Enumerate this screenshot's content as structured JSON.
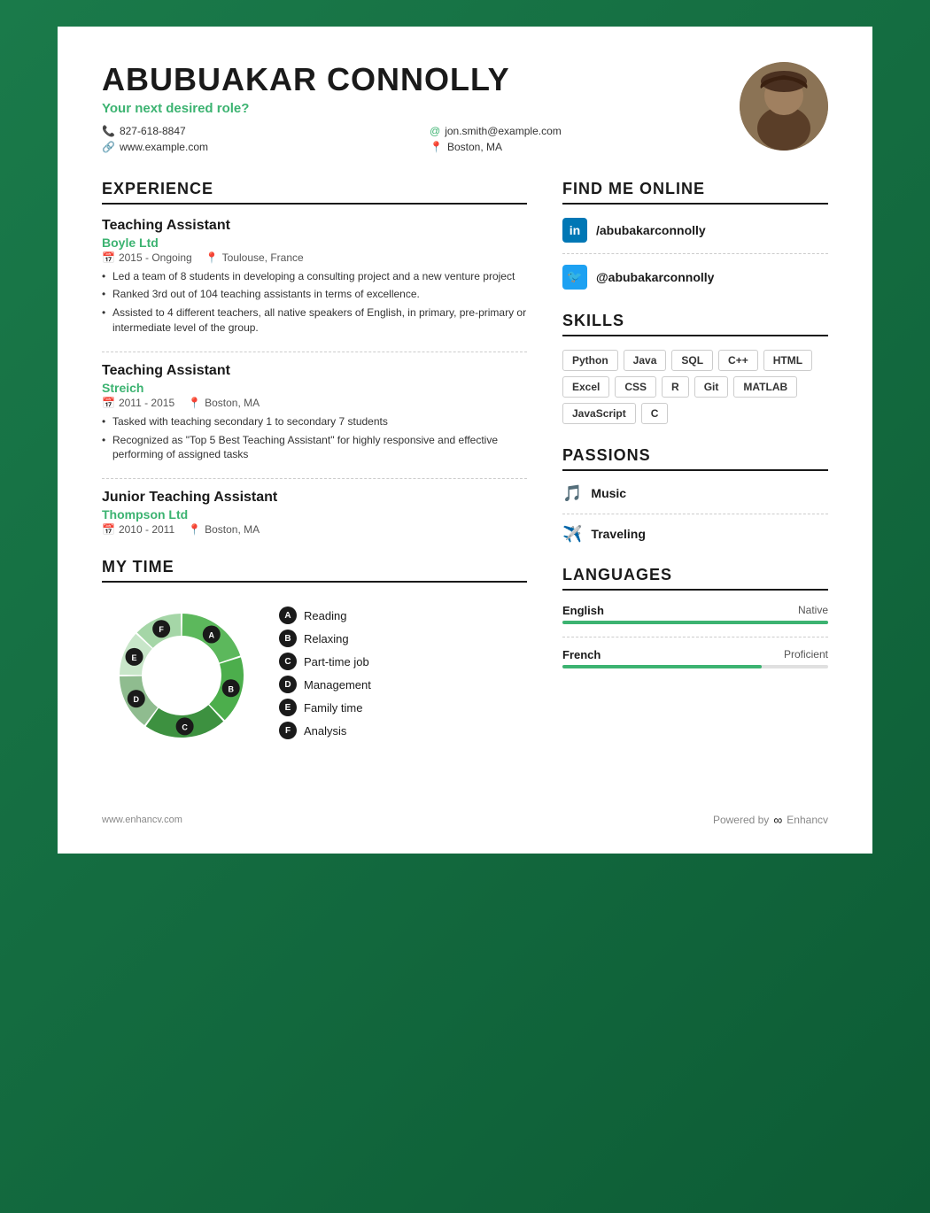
{
  "header": {
    "name": "ABUBUAKAR CONNOLLY",
    "role": "Your next desired role?",
    "phone": "827-618-8847",
    "email": "jon.smith@example.com",
    "website": "www.example.com",
    "location": "Boston, MA",
    "avatar_alt": "Profile photo"
  },
  "experience": {
    "section_title": "EXPERIENCE",
    "jobs": [
      {
        "title": "Teaching Assistant",
        "company": "Boyle Ltd",
        "period": "2015 - Ongoing",
        "location": "Toulouse, France",
        "bullets": [
          "Led a team of 8 students in developing a consulting project and a new venture project",
          "Ranked 3rd out of 104 teaching assistants in terms of excellence.",
          "Assisted to 4 different teachers, all native speakers of English, in primary, pre-primary or intermediate level of the group."
        ]
      },
      {
        "title": "Teaching Assistant",
        "company": "Streich",
        "period": "2011 - 2015",
        "location": "Boston, MA",
        "bullets": [
          "Tasked with teaching secondary 1 to secondary 7 students",
          "Recognized as \"Top 5 Best Teaching Assistant\" for highly responsive and effective performing of assigned tasks"
        ]
      },
      {
        "title": "Junior Teaching Assistant",
        "company": "Thompson Ltd",
        "period": "2010 - 2011",
        "location": "Boston, MA",
        "bullets": []
      }
    ]
  },
  "my_time": {
    "section_title": "MY TIME",
    "segments": [
      {
        "label": "A",
        "name": "Reading",
        "color": "#5cb85c",
        "percent": 20
      },
      {
        "label": "B",
        "name": "Relaxing",
        "color": "#4cae4c",
        "percent": 18
      },
      {
        "label": "C",
        "name": "Part-time job",
        "color": "#3d9140",
        "percent": 22
      },
      {
        "label": "D",
        "name": "Management",
        "color": "#8fbc8f",
        "percent": 15
      },
      {
        "label": "E",
        "name": "Family time",
        "color": "#c8e6c9",
        "percent": 12
      },
      {
        "label": "F",
        "name": "Analysis",
        "color": "#a5d6a7",
        "percent": 13
      }
    ]
  },
  "find_me_online": {
    "section_title": "FIND ME ONLINE",
    "linkedin": "/abubakarconnolly",
    "twitter": "@abubakarconnolly"
  },
  "skills": {
    "section_title": "SKILLS",
    "items": [
      "Python",
      "Java",
      "SQL",
      "C++",
      "HTML",
      "Excel",
      "CSS",
      "R",
      "Git",
      "MATLAB",
      "JavaScript",
      "C"
    ]
  },
  "passions": {
    "section_title": "PASSIONS",
    "items": [
      {
        "icon": "♪",
        "name": "Music"
      },
      {
        "icon": "✈",
        "name": "Traveling"
      }
    ]
  },
  "languages": {
    "section_title": "LANGUAGES",
    "items": [
      {
        "name": "English",
        "level": "Native",
        "percent": 100
      },
      {
        "name": "French",
        "level": "Proficient",
        "percent": 75
      }
    ]
  },
  "footer": {
    "website": "www.enhancv.com",
    "powered_by": "Powered by",
    "brand": "Enhancv"
  }
}
